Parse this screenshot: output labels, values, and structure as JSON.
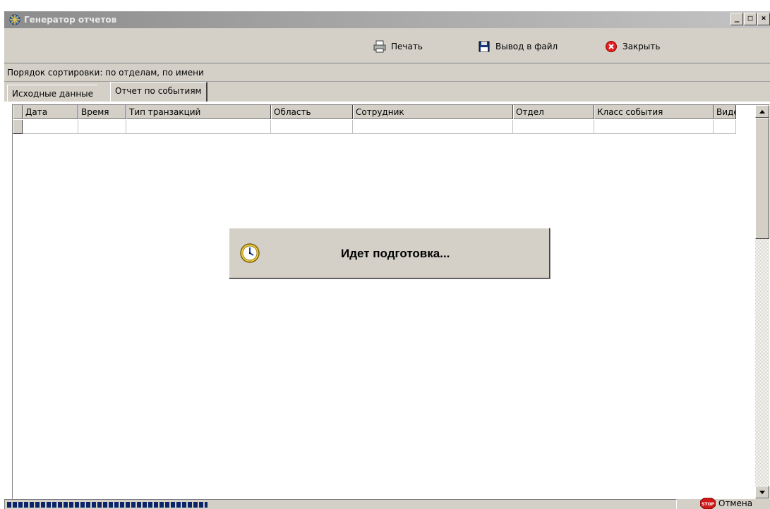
{
  "window": {
    "title": "Генератор отчетов",
    "controls": {
      "minimize": "_",
      "maximize": "□",
      "close": "×"
    }
  },
  "toolbar": {
    "print_label": "Печать",
    "export_label": "Вывод в файл",
    "close_label": "Закрыть"
  },
  "sort_order": "Порядок сортировки: по отделам, по имени",
  "tabs": [
    {
      "label": "Исходные данные",
      "active": false
    },
    {
      "label": "Отчет по событиям",
      "active": true
    }
  ],
  "table": {
    "columns": [
      "Дата",
      "Время",
      "Тип транзакций",
      "Область",
      "Сотрудник",
      "Отдел",
      "Класс события",
      "Видео"
    ],
    "rows": [
      [
        "",
        "",
        "",
        "",
        "",
        "",
        "",
        ""
      ]
    ]
  },
  "progress_dialog": {
    "message": "Идет подготовка...",
    "icon": "clock-icon"
  },
  "statusbar": {
    "progress": 0.3,
    "cancel_label": "Отмена",
    "cancel_icon": "stop-icon"
  },
  "colors": {
    "title_gradient_start": "#8c8c8c",
    "title_gradient_end": "#c3c3c3",
    "face": "#d4d0c8",
    "progress_fill": "#0a246a"
  }
}
